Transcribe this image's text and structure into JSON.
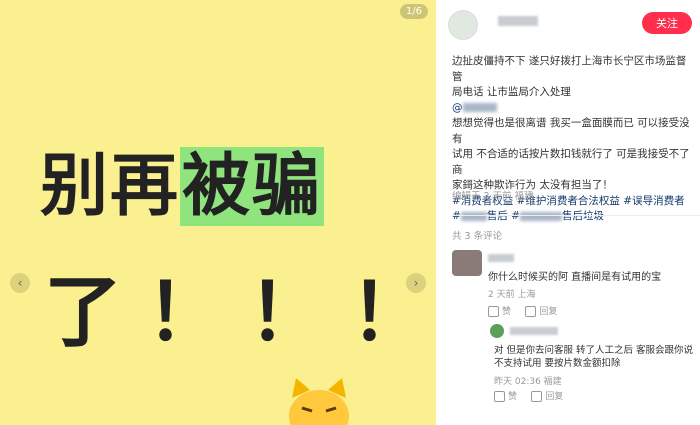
{
  "image_panel": {
    "counter": "1/6",
    "line1_part1": "别再",
    "line1_highlight": "被骗",
    "line2": "了！！！"
  },
  "author": {
    "follow_label": "关注"
  },
  "post": {
    "line1": "边扯皮僵持不下 遂只好拨打上海市长宁区市场监督管",
    "line2": "局电话 让市监局介入处理",
    "mention": "@",
    "line3": "想想觉得也是很离谱 我买一盒面膜而已 可以接受没有",
    "line4": "试用 不合适的话按片数扣钱就行了 可是我接受不了商",
    "line5": "家鎶这种欺诈行为 太没有担当了！",
    "tags_line1": "#消费者权益 #维护消费者合法权益 #误导消费者",
    "tag_a_suffix": "售后 #",
    "tag_b_suffix": "售后垃圾",
    "meta": "编辑于 2 天前 福建"
  },
  "comments": {
    "count": "共 3 条评论",
    "c1": {
      "text": "你什么时候买的阿 直播间是有试用的宝",
      "meta": "2 天前 上海",
      "like": "赞",
      "reply": "回复"
    },
    "c2": {
      "text_line1": "对 但是你去问客服 转了人工之后 客服会跟你说",
      "text_line2": "不支持试用 要按片数金额扣除",
      "meta": "昨天 02:36 福建",
      "like": "赞",
      "reply": "回复"
    }
  }
}
